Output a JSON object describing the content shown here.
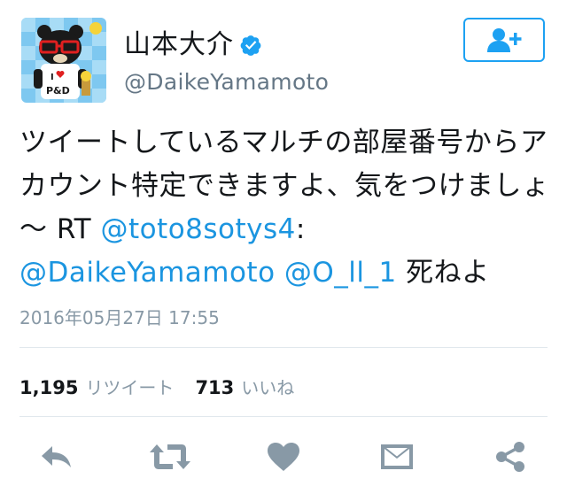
{
  "user": {
    "display_name": "山本大介",
    "handle": "@DaikeYamamoto",
    "avatar_text": "I ♥ P&D"
  },
  "tweet": {
    "text_main": "ツイートしているマルチの部屋番号からアカウント特定できますよ、気をつけましょ～ RT ",
    "mention_1": "@toto8sotys4",
    "colon": ":",
    "mention_2": "@DaikeYamamoto",
    "mention_3": "@O_ll_1",
    "text_end": " 死ねよ",
    "timestamp": "2016年05月27日 17:55"
  },
  "stats": {
    "retweets_count": "1,195",
    "retweets_label": "リツイート",
    "likes_count": "713",
    "likes_label": "いいね"
  },
  "colors": {
    "accent": "#1da1f2",
    "link": "#1b95e0",
    "icon_gray": "#8899a6",
    "muted": "#657786"
  },
  "icons": [
    "verified-icon",
    "follow-user-icon",
    "reply-icon",
    "retweet-icon",
    "like-icon",
    "message-icon",
    "share-icon"
  ]
}
